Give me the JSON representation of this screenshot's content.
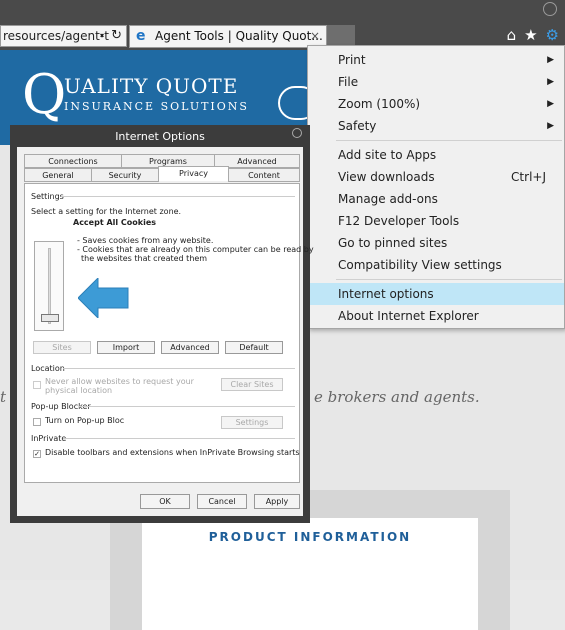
{
  "browser": {
    "address_text": "resources/agent-t",
    "address_caret": "▾",
    "refresh_glyph": "↻",
    "tab_icon_glyph": "e",
    "tab_title": "Agent Tools | Quality Quot...",
    "tab_close_glyph": "×",
    "home_glyph": "⌂",
    "favorites_glyph": "★",
    "gear_glyph": "⚙"
  },
  "banner": {
    "logo_q": "Q",
    "logo_line1": "UALITY QUOTE",
    "logo_line2": "INSURANCE SOLUTIONS"
  },
  "page": {
    "tagline_left": "t",
    "tagline_right": "e brokers and agents.",
    "product_heading": "PRODUCT INFORMATION"
  },
  "menu": {
    "items": [
      {
        "label": "Print",
        "arrow": "▶"
      },
      {
        "label": "File",
        "arrow": "▶"
      },
      {
        "label": "Zoom (100%)",
        "arrow": "▶"
      },
      {
        "label": "Safety",
        "arrow": "▶"
      },
      {
        "label": "Add site to Apps"
      },
      {
        "label": "View downloads",
        "shortcut": "Ctrl+J"
      },
      {
        "label": "Manage add-ons"
      },
      {
        "label": "F12 Developer Tools"
      },
      {
        "label": "Go to pinned sites"
      },
      {
        "label": "Compatibility View settings"
      },
      {
        "label": "Internet options",
        "highlighted": true
      },
      {
        "label": "About Internet Explorer"
      }
    ]
  },
  "dialog": {
    "title": "Internet Options",
    "tabs_row1": [
      "Connections",
      "Programs",
      "Advanced"
    ],
    "tabs_row2": [
      "General",
      "Security",
      "Privacy",
      "Content"
    ],
    "selected_tab": "Privacy",
    "settings_label": "Settings",
    "zone_instruction": "Select a setting for the Internet zone.",
    "level_title": "Accept All Cookies",
    "level_desc1": "- Saves cookies from any website.",
    "level_desc2": "- Cookies that are already on this computer can be read by",
    "level_desc3": "the websites that created them",
    "buttons": {
      "sites": "Sites",
      "import": "Import",
      "advanced": "Advanced",
      "default": "Default"
    },
    "location_label": "Location",
    "location_check_line1": "Never allow websites to request your",
    "location_check_line2": "physical location",
    "clear_sites": "Clear Sites",
    "popup_label": "Pop-up Blocker",
    "popup_check": "Turn on Pop-up Bloc",
    "popup_settings": "Settings",
    "inprivate_label": "InPrivate",
    "inprivate_check": "Disable toolbars and extensions when InPrivate Browsing starts",
    "inprivate_checked_glyph": "✓",
    "ok": "OK",
    "cancel": "Cancel",
    "apply": "Apply"
  },
  "colors": {
    "banner_blue": "#1f6aa3",
    "menu_highlight": "#bfe6f7",
    "callout_arrow": "#3d9bd6",
    "product_heading": "#1f5f99"
  }
}
